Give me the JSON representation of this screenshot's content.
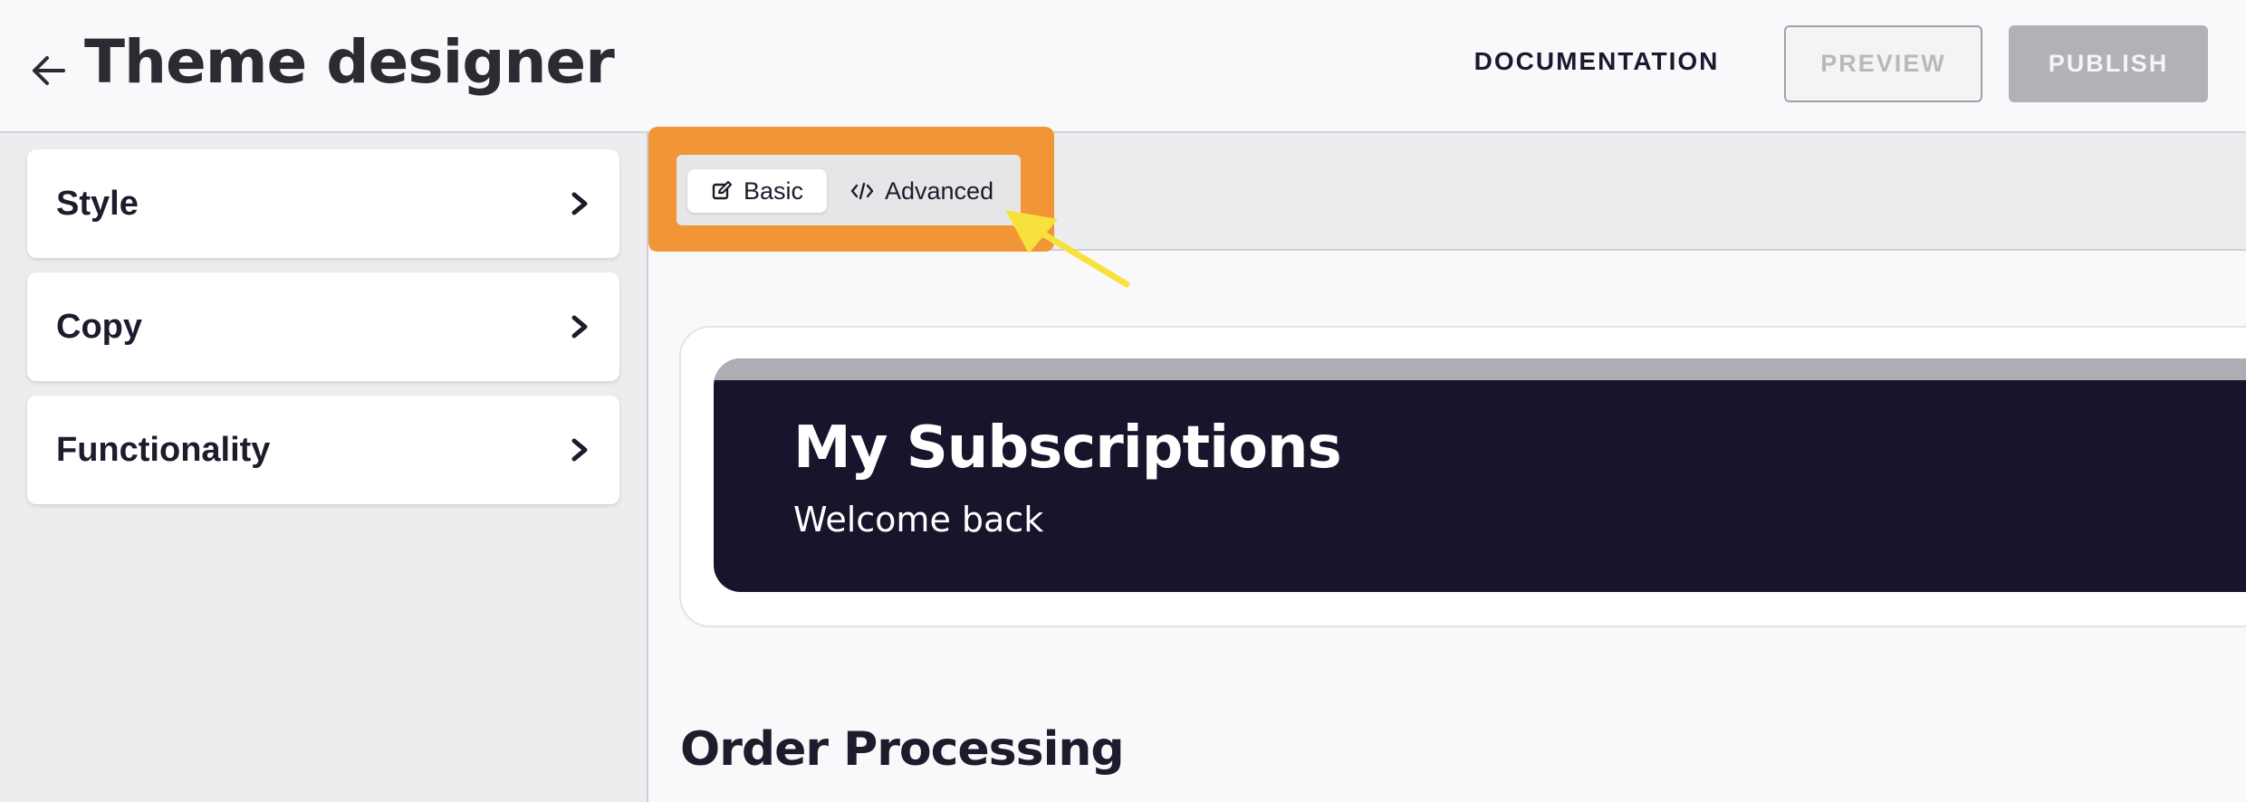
{
  "header": {
    "title": "Theme designer",
    "documentation_label": "DOCUMENTATION",
    "preview_label": "PREVIEW",
    "publish_label": "PUBLISH"
  },
  "sidebar": {
    "items": [
      {
        "label": "Style"
      },
      {
        "label": "Copy"
      },
      {
        "label": "Functionality"
      }
    ]
  },
  "editor_tabs": {
    "basic_label": "Basic",
    "advanced_label": "Advanced",
    "active": "Basic"
  },
  "preview": {
    "banner_title": "My Subscriptions",
    "banner_subtitle": "Welcome back",
    "section_title": "Order Processing"
  },
  "colors": {
    "highlight": "#f29537",
    "annotation_arrow": "#f7e23d",
    "banner_background": "#17152c"
  },
  "icons": {
    "back": "arrow-left-icon",
    "chevron": "chevron-right-icon",
    "basic_tab": "edit-square-icon",
    "advanced_tab": "code-icon"
  }
}
